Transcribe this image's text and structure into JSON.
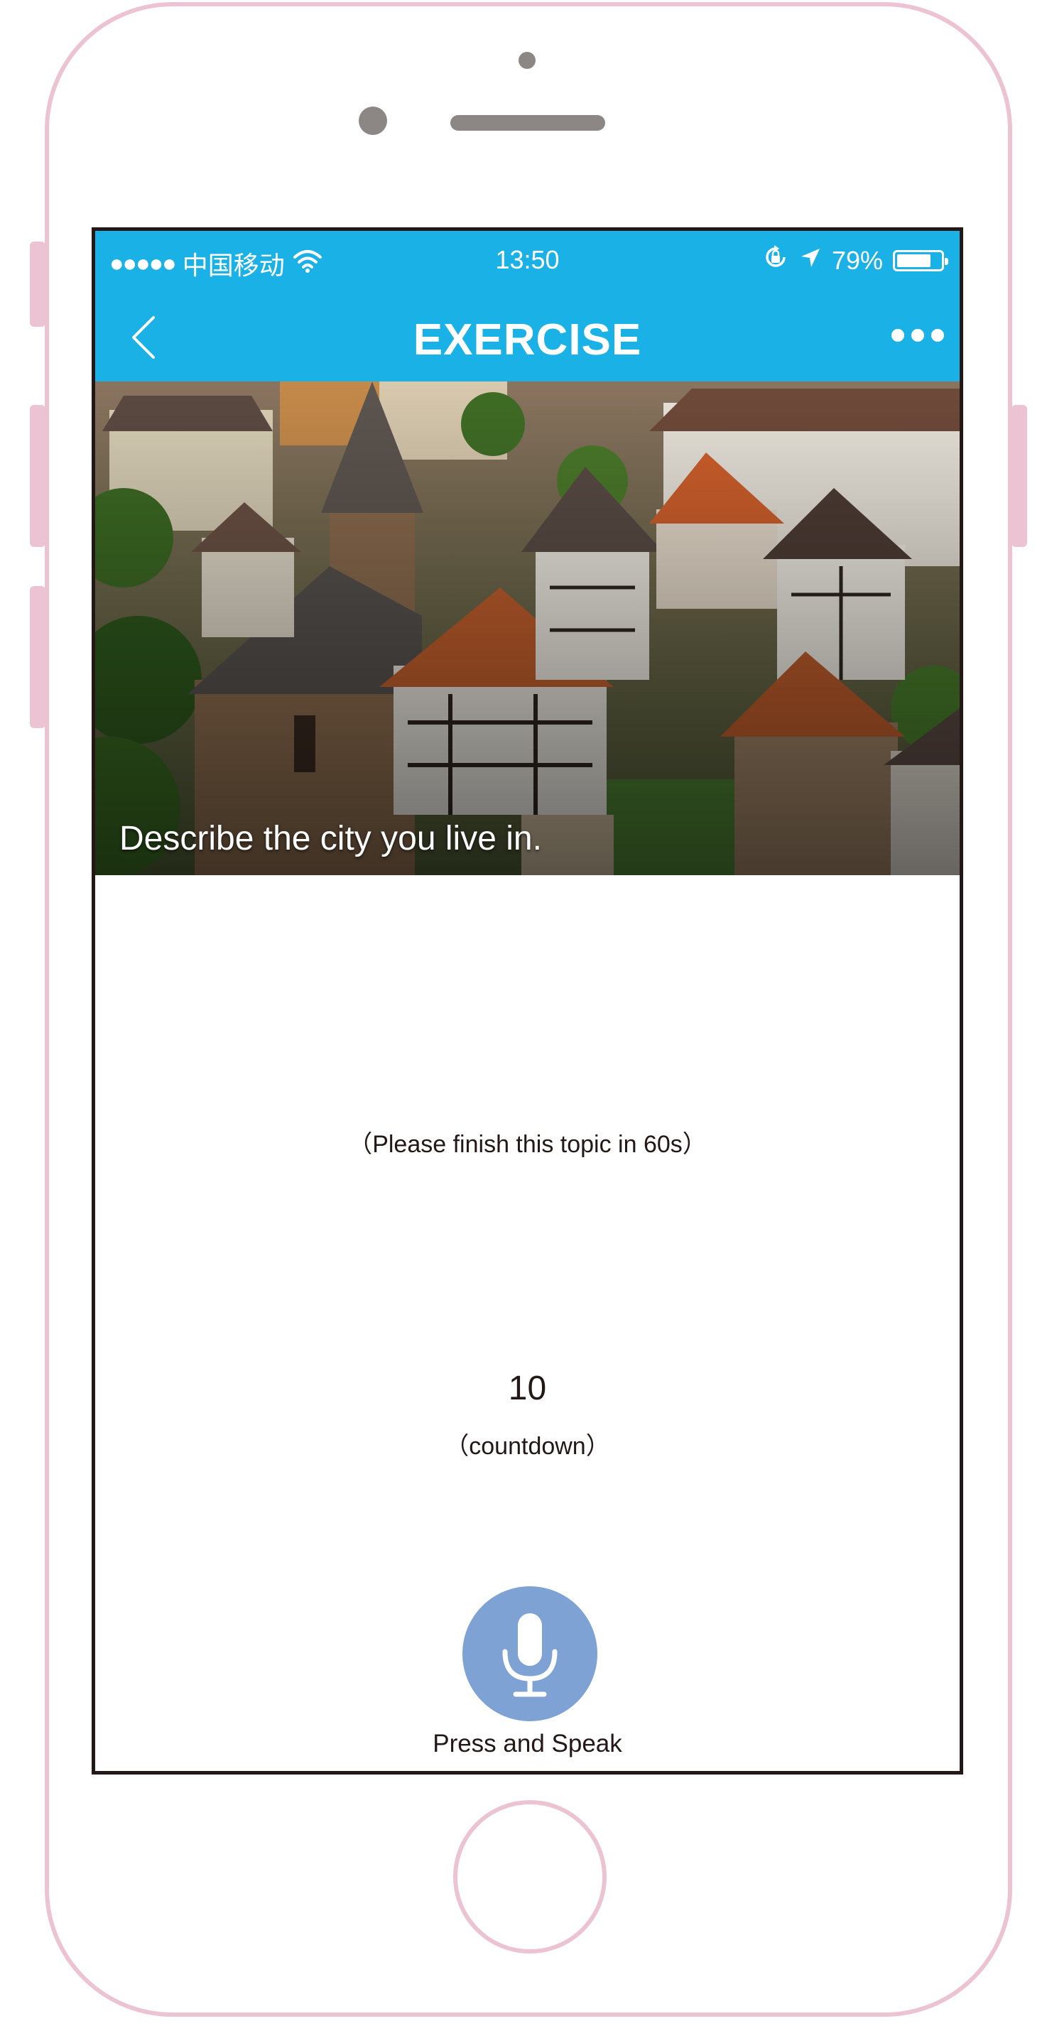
{
  "status_bar": {
    "signal": "●●●●●",
    "carrier": "中国移动",
    "time": "13:50",
    "battery_percent": "79%",
    "battery_level": 0.79,
    "icons": [
      "wifi-icon",
      "rotation-lock-icon",
      "location-arrow-icon",
      "battery-icon"
    ]
  },
  "navbar": {
    "title": "EXERCISE",
    "back_icon": "chevron-left-icon",
    "more_icon": "more-dots-icon"
  },
  "hero": {
    "caption": "Describe the city you live in."
  },
  "exercise": {
    "hint": "（Please finish this topic in 60s）",
    "countdown_value": "10",
    "countdown_label": "（countdown）"
  },
  "speak": {
    "label": "Press and Speak",
    "icon": "microphone-icon"
  },
  "colors": {
    "header": "#1ab1e6",
    "mic_button": "#7fa2d4",
    "phone_frame": "#ecc3d3",
    "text": "#231815"
  }
}
